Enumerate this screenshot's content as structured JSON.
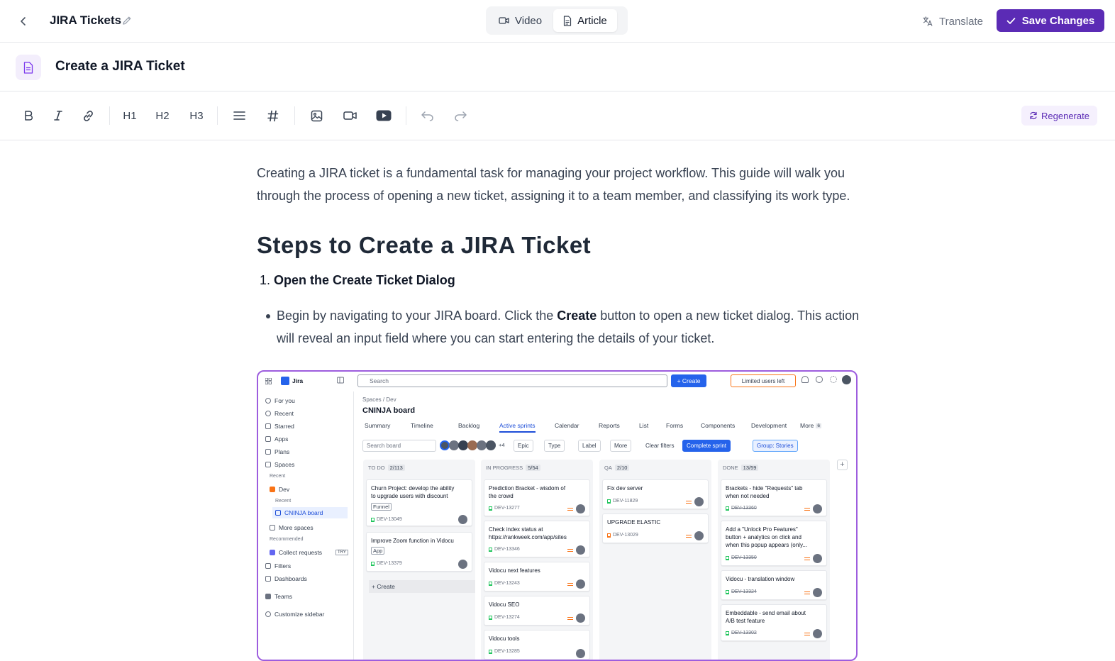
{
  "topbar": {
    "doc_title": "JIRA Tickets",
    "tabs": [
      {
        "label": "Video",
        "icon": "video-icon",
        "active": false
      },
      {
        "label": "Article",
        "icon": "document-icon",
        "active": true
      }
    ],
    "translate_label": "Translate",
    "save_label": "Save Changes"
  },
  "article": {
    "title": "Create a JIRA Ticket"
  },
  "toolbar": {
    "h1": "H1",
    "h2": "H2",
    "h3": "H3",
    "regenerate_label": "Regenerate"
  },
  "content": {
    "intro": "Creating a JIRA ticket is a fundamental task for managing your project workflow. This guide will walk you through the process of opening a new ticket, assigning it to a team member, and classifying its work type.",
    "heading": "Steps to Create a JIRA Ticket",
    "step1_number": "1.",
    "step1_title": "Open the Create Ticket Dialog",
    "bullet1_pre": "Begin by navigating to your JIRA board. Click the ",
    "bullet1_bold": "Create",
    "bullet1_post": " button to open a new ticket dialog. This action will reveal an input field where you can start entering the details of your ticket."
  },
  "screenshot": {
    "brand": "Jira",
    "search_placeholder": "Search",
    "create_label": "+ Create",
    "limited_label": "Limited users left",
    "sidebar": {
      "for_you": "For you",
      "recent": "Recent",
      "starred": "Starred",
      "apps": "Apps",
      "plans": "Plans",
      "spaces": "Spaces",
      "recent_section": "Recent",
      "dev": "Dev",
      "dev_recent": "Recent",
      "cninja_board": "CNINJA board",
      "more_spaces": "More spaces",
      "recommended": "Recommended",
      "collect_requests": "Collect requests",
      "try": "TRY",
      "filters": "Filters",
      "dashboards": "Dashboards",
      "teams": "Teams",
      "customize": "Customize sidebar"
    },
    "breadcrumb": "Spaces  /  Dev",
    "board_title": "CNINJA board",
    "tabs": [
      "Summary",
      "Timeline",
      "Backlog",
      "Active sprints",
      "Calendar",
      "Reports",
      "List",
      "Forms",
      "Components",
      "Development",
      "More"
    ],
    "more_count": "6",
    "search_board": "Search board",
    "avatars_more": "+4",
    "filters": [
      "Epic",
      "Type",
      "Label",
      "More"
    ],
    "clear_filters": "Clear filters",
    "complete_sprint": "Complete sprint",
    "group_label": "Group: Stories",
    "columns": [
      {
        "name": "TO DO",
        "count": "2/113",
        "cards": [
          {
            "title": "Churn Project: develop the ability to upgrade users with discount",
            "tag": "Funnel",
            "id": "DEV-13049",
            "done": false
          },
          {
            "title": "Improve Zoom function in Vidocu",
            "tag": "App",
            "id": "DEV-13379",
            "done": false
          }
        ],
        "create_label": "+ Create"
      },
      {
        "name": "IN PROGRESS",
        "count": "5/54",
        "cards": [
          {
            "title": "Prediction Bracket - wisdom of the crowd",
            "tag": "",
            "id": "DEV-13277",
            "done": false
          },
          {
            "title": "Check index status at https://rankweek.com/app/sites",
            "tag": "",
            "id": "DEV-13346",
            "done": false
          },
          {
            "title": "Vidocu next features",
            "tag": "",
            "id": "DEV-13243",
            "done": false
          },
          {
            "title": "Vidocu SEO",
            "tag": "",
            "id": "DEV-13274",
            "done": false
          },
          {
            "title": "Vidocu tools",
            "tag": "",
            "id": "DEV-13285",
            "done": false
          }
        ]
      },
      {
        "name": "QA",
        "count": "2/10",
        "cards": [
          {
            "title": "Fix dev server",
            "tag": "",
            "id": "DEV-11829",
            "done": false
          },
          {
            "title": "UPGRADE ELASTIC",
            "tag": "",
            "id": "DEV-13029",
            "done": false
          }
        ]
      },
      {
        "name": "DONE",
        "count": "13/59",
        "cards": [
          {
            "title": "Brackets - hide \"Requests\" tab when not needed",
            "tag": "",
            "id": "DEV-13360",
            "done": true
          },
          {
            "title": "Add a \"Unlock Pro Features\" button + analytics on click and when this popup appears (only...",
            "tag": "",
            "id": "DEV-13350",
            "done": true
          },
          {
            "title": "Vidocu - translation window",
            "tag": "",
            "id": "DEV-13324",
            "done": true
          },
          {
            "title": "Embeddable - send email about A/B test feature",
            "tag": "",
            "id": "DEV-13302",
            "done": true
          }
        ]
      }
    ]
  },
  "colors": {
    "accent": "#5b2bb5",
    "accent_light": "#f5f0fd",
    "jira_blue": "#2563eb"
  }
}
